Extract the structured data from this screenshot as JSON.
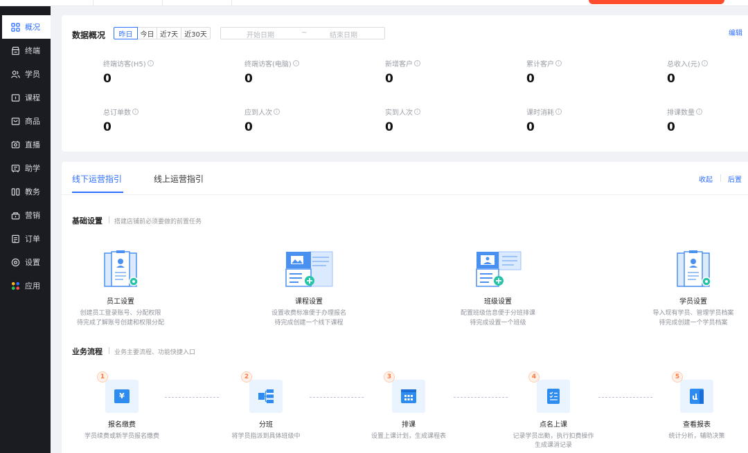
{
  "sidebar": {
    "items": [
      {
        "label": "概况",
        "icon": "grid-icon"
      },
      {
        "label": "终端",
        "icon": "store-icon"
      },
      {
        "label": "学员",
        "icon": "users-icon"
      },
      {
        "label": "课程",
        "icon": "course-icon"
      },
      {
        "label": "商品",
        "icon": "goods-icon"
      },
      {
        "label": "直播",
        "icon": "live-icon"
      },
      {
        "label": "助学",
        "icon": "study-icon"
      },
      {
        "label": "教务",
        "icon": "academic-icon"
      },
      {
        "label": "营销",
        "icon": "marketing-icon"
      },
      {
        "label": "订单",
        "icon": "order-icon"
      },
      {
        "label": "设置",
        "icon": "settings-icon"
      },
      {
        "label": "应用",
        "icon": "apps-icon"
      }
    ],
    "active_index": 0
  },
  "overview": {
    "title": "数据概况",
    "ranges": [
      "昨日",
      "今日",
      "近7天",
      "近30天"
    ],
    "active_range": "昨日",
    "date_start_placeholder": "开始日期",
    "date_sep": "~",
    "date_end_placeholder": "结束日期",
    "edit": "编辑",
    "stats": [
      {
        "label": "终端访客(H5)",
        "value": "0"
      },
      {
        "label": "终端访客(电脑)",
        "value": "0"
      },
      {
        "label": "新增客户",
        "value": "0"
      },
      {
        "label": "累计客户",
        "value": "0"
      },
      {
        "label": "总收入(元)",
        "value": "0"
      },
      {
        "label": "总订单数",
        "value": "0"
      },
      {
        "label": "应到人次",
        "value": "0"
      },
      {
        "label": "实到人次",
        "value": "0"
      },
      {
        "label": "课时消耗",
        "value": "0"
      },
      {
        "label": "排课数量",
        "value": "0"
      }
    ]
  },
  "guide": {
    "tabs": [
      "线下运营指引",
      "线上运营指引"
    ],
    "active_tab": "线下运营指引",
    "collapse": "收起",
    "later": "后置",
    "basic_title": "基础设置",
    "basic_sub": "搭建店铺前必须要做的前置任务",
    "setups": [
      {
        "name": "员工设置",
        "desc1": "创建员工登录账号、分配权限",
        "desc2": "待完成了解账号创建和权限分配"
      },
      {
        "name": "课程设置",
        "desc1": "设置收费标准便于办理报名",
        "desc2": "待完成创建一个线下课程"
      },
      {
        "name": "班级设置",
        "desc1": "配置班级信息便于分班排课",
        "desc2": "待完成设置一个班级"
      },
      {
        "name": "学员设置",
        "desc1": "导入现有学员、管理学员档案",
        "desc2": "待完成创建一个学员档案"
      }
    ],
    "flow_title": "业务流程",
    "flow_sub": "业务主要流程、功能快捷入口",
    "flows": [
      {
        "num": "1",
        "name": "报名缴费",
        "desc1": "学员续费或新学员报名缴费",
        "desc2": ""
      },
      {
        "num": "2",
        "name": "分班",
        "desc1": "将学员指派到具体班级中",
        "desc2": ""
      },
      {
        "num": "3",
        "name": "排课",
        "desc1": "设置上课计划，生成课程表",
        "desc2": ""
      },
      {
        "num": "4",
        "name": "点名上课",
        "desc1": "记录学员出勤，执行扣费操作",
        "desc2": "生成课消记录"
      },
      {
        "num": "5",
        "name": "查看报表",
        "desc1": "统计分析，辅助决策",
        "desc2": ""
      }
    ]
  },
  "colors": {
    "accent": "#2f6fff",
    "sidebar_bg": "#1a1c21",
    "step_orange": "#ff7a3d"
  }
}
